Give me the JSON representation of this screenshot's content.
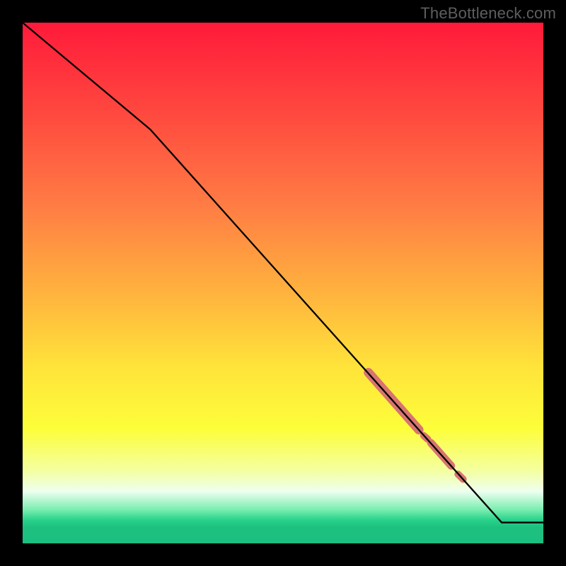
{
  "watermark": {
    "text": "TheBottleneck.com"
  },
  "plot": {
    "margin_left": 32,
    "margin_right": 32,
    "margin_top": 32,
    "margin_bottom": 32,
    "inner_width": 736,
    "inner_height": 736
  },
  "chart_data": {
    "type": "line",
    "title": "",
    "xlabel": "",
    "ylabel": "",
    "xlim_frac": [
      0,
      1
    ],
    "ylim_frac": [
      0,
      1
    ],
    "gradient_stops": [
      {
        "offset": 0.0,
        "color": "#ff1a3a"
      },
      {
        "offset": 0.18,
        "color": "#ff4a3f"
      },
      {
        "offset": 0.35,
        "color": "#ff7c44"
      },
      {
        "offset": 0.52,
        "color": "#ffb33e"
      },
      {
        "offset": 0.66,
        "color": "#ffe33a"
      },
      {
        "offset": 0.78,
        "color": "#fdfe3a"
      },
      {
        "offset": 0.86,
        "color": "#f4ffa0"
      },
      {
        "offset": 0.9,
        "color": "#eefff0"
      },
      {
        "offset": 0.935,
        "color": "#7beeb0"
      },
      {
        "offset": 0.955,
        "color": "#29d28b"
      },
      {
        "offset": 0.97,
        "color": "#1dc07f"
      },
      {
        "offset": 1.0,
        "color": "#1cbf80"
      }
    ],
    "series": [
      {
        "name": "curve",
        "stroke": "#000000",
        "stroke_width": 2.3,
        "points_frac": [
          {
            "x": 0.0,
            "y": 1.0
          },
          {
            "x": 0.245,
            "y": 0.795
          },
          {
            "x": 0.92,
            "y": 0.04
          },
          {
            "x": 1.0,
            "y": 0.04
          }
        ]
      }
    ],
    "highlights": {
      "stroke": "#d8746f",
      "segments_frac": [
        {
          "x1": 0.664,
          "y1": 0.328,
          "x2": 0.761,
          "y2": 0.218,
          "width": 13
        },
        {
          "x1": 0.784,
          "y1": 0.193,
          "x2": 0.823,
          "y2": 0.149,
          "width": 11
        },
        {
          "x1": 0.77,
          "y1": 0.207,
          "x2": 0.778,
          "y2": 0.2,
          "width": 10
        },
        {
          "x1": 0.836,
          "y1": 0.133,
          "x2": 0.846,
          "y2": 0.123,
          "width": 10
        }
      ]
    }
  }
}
